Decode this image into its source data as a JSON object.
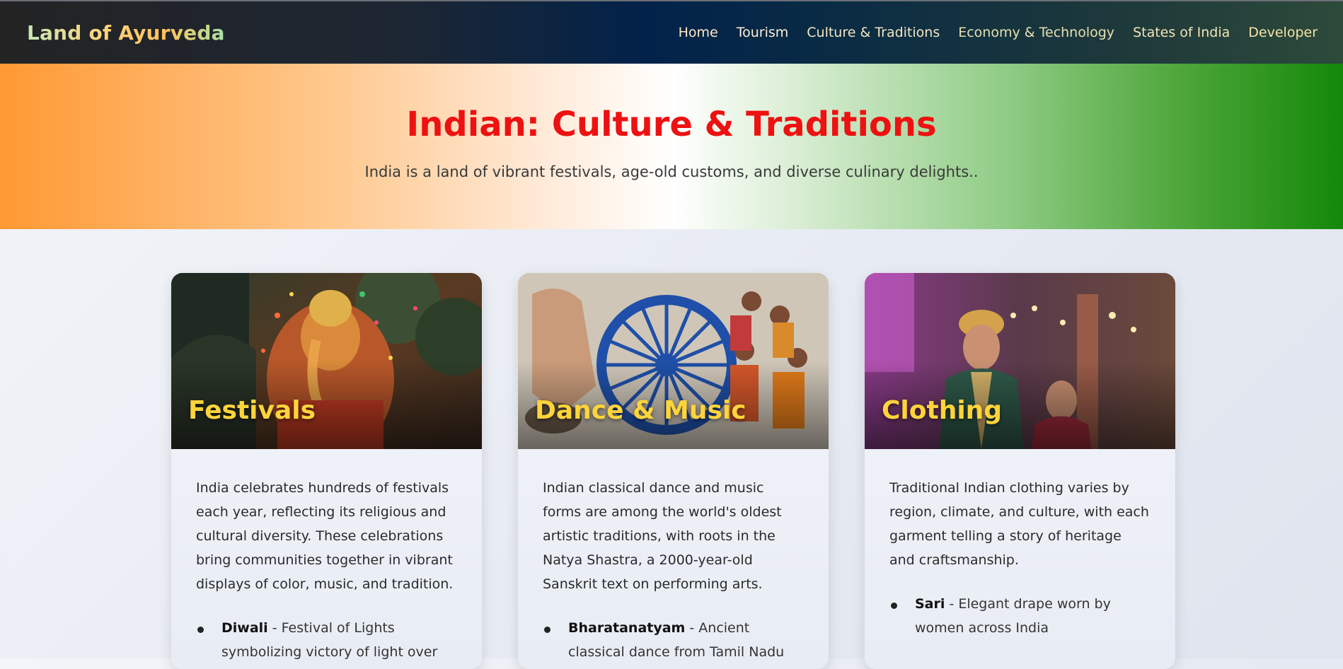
{
  "brand": {
    "title": "Land of Ayurveda"
  },
  "nav": {
    "items": [
      {
        "label": "Home"
      },
      {
        "label": "Tourism"
      },
      {
        "label": "Culture & Traditions"
      },
      {
        "label": "Economy & Technology"
      },
      {
        "label": "States of India"
      },
      {
        "label": "Developer"
      }
    ]
  },
  "hero": {
    "title": "Indian: Culture & Traditions",
    "subtitle": "India is a land of vibrant festivals, age-old customs, and diverse culinary delights.."
  },
  "cards": [
    {
      "title": "Festivals",
      "description": "India celebrates hundreds of festivals each year, reflecting its religious and cultural diversity. These celebrations bring communities together in vibrant displays of color, music, and tradition.",
      "items": [
        {
          "name": "Diwali",
          "desc": " - Festival of Lights symbolizing victory of light over"
        }
      ]
    },
    {
      "title": "Dance & Music",
      "description": "Indian classical dance and music forms are among the world's oldest artistic traditions, with roots in the Natya Shastra, a 2000-year-old Sanskrit text on performing arts.",
      "items": [
        {
          "name": "Bharatanatyam",
          "desc": " - Ancient classical dance from Tamil Nadu"
        }
      ]
    },
    {
      "title": "Clothing",
      "description": "Traditional Indian clothing varies by region, climate, and culture, with each garment telling a story of heritage and craftsmanship.",
      "items": [
        {
          "name": "Sari",
          "desc": " - Elegant drape worn by women across India"
        }
      ]
    }
  ],
  "colors": {
    "saffron": "#ff9933",
    "green": "#138808",
    "hero_title": "#ee1111",
    "card_title": "#ffd43b"
  }
}
